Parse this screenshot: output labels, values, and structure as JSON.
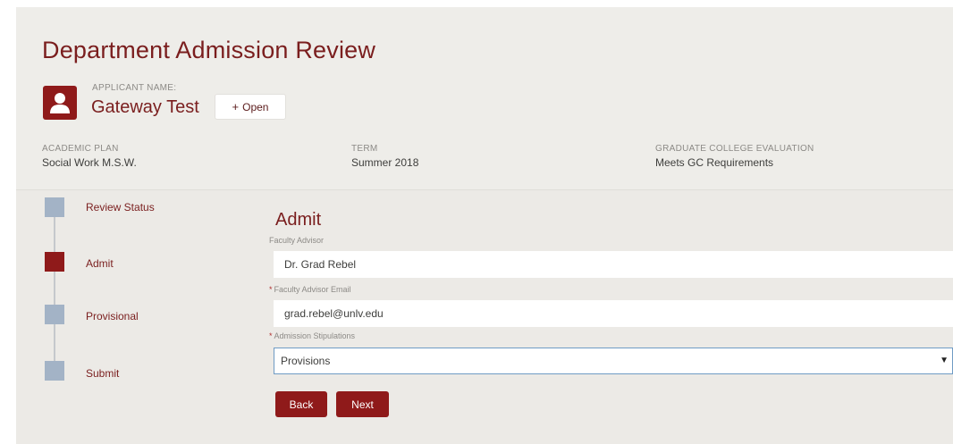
{
  "page": {
    "title": "Department Admission Review"
  },
  "applicant": {
    "label": "APPLICANT NAME:",
    "name": "Gateway Test",
    "open_button": "Open"
  },
  "fields": [
    {
      "label": "ACADEMIC PLAN",
      "value": "Social Work M.S.W."
    },
    {
      "label": "TERM",
      "value": "Summer 2018"
    },
    {
      "label": "GRADUATE COLLEGE EVALUATION",
      "value": "Meets GC Requirements"
    }
  ],
  "steps": [
    {
      "label": "Review Status",
      "active": false
    },
    {
      "label": "Admit",
      "active": true
    },
    {
      "label": "Provisional",
      "active": false
    },
    {
      "label": "Submit",
      "active": false
    }
  ],
  "form": {
    "section_title": "Admit",
    "faculty_advisor": {
      "label": "Faculty Advisor",
      "value": "Dr. Grad Rebel"
    },
    "faculty_email": {
      "required_mark": "*",
      "label": "Faculty Advisor Email",
      "value": "grad.rebel@unlv.edu"
    },
    "stipulations": {
      "required_mark": "*",
      "label": "Admission Stipulations",
      "selected": "Provisions"
    },
    "back_button": "Back",
    "next_button": "Next"
  },
  "colors": {
    "brand": "#8f1a1a",
    "step_inactive": "#a3b3c6",
    "background": "#eceae6"
  },
  "icons": {
    "applicant": "user-icon",
    "open": "plus-icon",
    "dropdown": "caret-down-icon"
  }
}
